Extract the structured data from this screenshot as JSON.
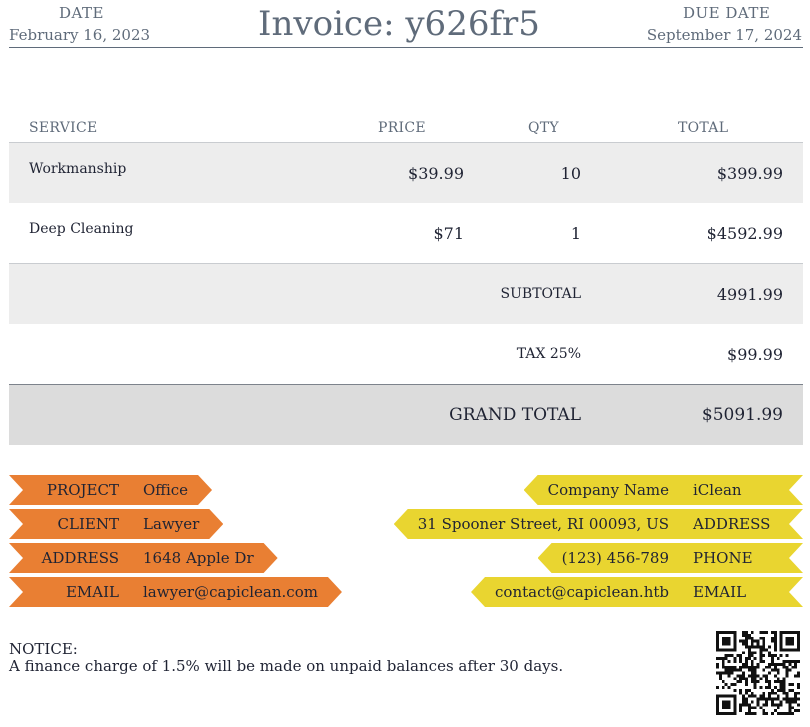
{
  "header": {
    "date_label": "DATE",
    "date_value": "February 16, 2023",
    "title": "Invoice: y626fr5",
    "due_label": "DUE DATE",
    "due_value": "September 17, 2024"
  },
  "table": {
    "columns": [
      "SERVICE",
      "PRICE",
      "QTY",
      "TOTAL"
    ],
    "rows": [
      {
        "service": "Workmanship",
        "price": "$39.99",
        "qty": "10",
        "total": "$399.99"
      },
      {
        "service": "Deep Cleaning",
        "price": "$71",
        "qty": "1",
        "total": "$4592.99"
      }
    ],
    "subtotal_label": "SUBTOTAL",
    "subtotal_value": "4991.99",
    "tax_label": "TAX 25%",
    "tax_value": "$99.99",
    "grand_label": "GRAND TOTAL",
    "grand_value": "$5091.99"
  },
  "client_tags": [
    {
      "label": "PROJECT",
      "value": "Office"
    },
    {
      "label": "CLIENT",
      "value": "Lawyer"
    },
    {
      "label": "ADDRESS",
      "value": "1648 Apple Dr"
    },
    {
      "label": "EMAIL",
      "value": "lawyer@capiclean.com"
    }
  ],
  "company_tags": [
    {
      "value": "Company Name",
      "label": "iClean"
    },
    {
      "value": "31 Spooner Street, RI 00093, US",
      "label": "ADDRESS"
    },
    {
      "value": "(123) 456-789",
      "label": "PHONE"
    },
    {
      "value": "contact@capiclean.htb",
      "label": "EMAIL"
    }
  ],
  "notice": {
    "title": "NOTICE:",
    "text": "A finance charge of 1.5% will be made on unpaid balances after 30 days."
  },
  "colors": {
    "client_tag": "#e97f33",
    "company_tag": "#e9d530",
    "header_text": "#5f6b7a"
  },
  "icons": {
    "qr": "qr-code-icon"
  }
}
